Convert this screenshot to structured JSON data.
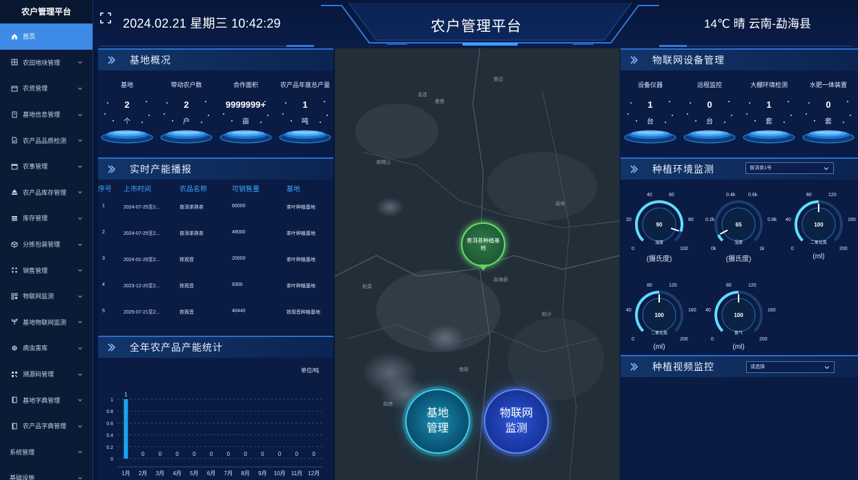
{
  "sidebar": {
    "brand": "农户管理平台",
    "items": [
      {
        "label": "首页",
        "icon": "home-icon",
        "active": true
      },
      {
        "label": "农田地块管理",
        "icon": "grid-icon"
      },
      {
        "label": "农资管理",
        "icon": "box-icon"
      },
      {
        "label": "基地信息管理",
        "icon": "document-icon"
      },
      {
        "label": "农产品品质检测",
        "icon": "file-check-icon"
      },
      {
        "label": "农事管理",
        "icon": "calendar-icon"
      },
      {
        "label": "农产品库存管理",
        "icon": "eject-icon"
      },
      {
        "label": "库存管理",
        "icon": "stack-icon"
      },
      {
        "label": "分拣包装管理",
        "icon": "package-icon"
      },
      {
        "label": "销售管理",
        "icon": "apps-icon"
      },
      {
        "label": "物联网监测",
        "icon": "device-grid-icon"
      },
      {
        "label": "基地物联网监测",
        "icon": "sprout-icon"
      },
      {
        "label": "病虫害库",
        "icon": "bug-icon"
      },
      {
        "label": "溯源码管理",
        "icon": "qrcode-icon"
      },
      {
        "label": "基地字典管理",
        "icon": "book-icon"
      },
      {
        "label": "农产品字典管理",
        "icon": "book-icon"
      },
      {
        "label": "系统管理",
        "icon": ""
      },
      {
        "label": "基础设施",
        "icon": ""
      }
    ]
  },
  "header": {
    "datetime": "2024.02.21 星期三 10:42:29",
    "title": "农户管理平台",
    "weather": "14℃  晴  云南-勐海县"
  },
  "base_overview": {
    "title": "基地概况",
    "stats": [
      {
        "name": "基地",
        "value": "2",
        "unit": "个"
      },
      {
        "name": "带动农户数",
        "value": "2",
        "unit": "户"
      },
      {
        "name": "合作面积",
        "value": "9999999+",
        "unit": "亩"
      },
      {
        "name": "农产品年度总产量",
        "value": "1",
        "unit": "吨"
      }
    ]
  },
  "realtime": {
    "title": "实时产能播报",
    "headers": [
      "序号",
      "上市时间",
      "农品名称",
      "可销售量",
      "基地"
    ],
    "rows": [
      [
        "1",
        "2024-07-25至2...",
        "普洱茶熟茶",
        "60000",
        "茶叶种植基地"
      ],
      [
        "2",
        "2024-07-25至2...",
        "普洱茶熟茶",
        "49000",
        "茶叶种植基地"
      ],
      [
        "3",
        "2024-01-29至2...",
        "铁观音",
        "20000",
        "茶叶种植基地"
      ],
      [
        "4",
        "2023-12-20至2...",
        "铁观音",
        "9300",
        "茶叶种植基地"
      ],
      [
        "5",
        "2025-07-21至2...",
        "铁观音",
        "40440",
        "铁观音种植基地"
      ]
    ]
  },
  "annual": {
    "title": "全年农产品产能统计",
    "unit": "单位/吨"
  },
  "chart_data": {
    "type": "bar",
    "categories": [
      "1月",
      "2月",
      "3月",
      "4月",
      "5月",
      "6月",
      "7月",
      "8月",
      "9月",
      "10月",
      "11月",
      "12月"
    ],
    "values": [
      1,
      0,
      0,
      0,
      0,
      0,
      0,
      0,
      0,
      0,
      0,
      0
    ],
    "ylim": [
      0,
      1
    ],
    "yticks": [
      "0",
      "0.2",
      "0.4",
      "0.6",
      "0.8",
      "1"
    ],
    "ylabel": "单位/吨",
    "grid": true
  },
  "map": {
    "marker_label": "普洱茶种植基地",
    "btn_base": "基地\n管理",
    "btn_iot": "物联网\n监测",
    "labels": [
      "孟连",
      "曼景",
      "勐海县",
      "南糯山",
      "勐宋",
      "帕真",
      "帕沙",
      "南板",
      "勐遮",
      "景迈"
    ]
  },
  "iot": {
    "title": "物联网设备管理",
    "stats": [
      {
        "name": "设备仪器",
        "value": "1",
        "unit": "台"
      },
      {
        "name": "远程监控",
        "value": "0",
        "unit": "台"
      },
      {
        "name": "大棚环境检测",
        "value": "1",
        "unit": "套"
      },
      {
        "name": "水肥一体装置",
        "value": "0",
        "unit": "套"
      }
    ]
  },
  "env": {
    "title": "种植环境监测",
    "select": "普洱茶1号",
    "gauges": [
      {
        "value": "90",
        "name": "温度",
        "unit": "(摄氏度)",
        "ticks": [
          "0",
          "20",
          "40",
          "60",
          "80",
          "100"
        ],
        "fraction": 0.9
      },
      {
        "value": "65",
        "name": "湿度",
        "unit": "(摄氏度)",
        "ticks": [
          "0k",
          "0.2k",
          "0.4k",
          "0.6k",
          "0.8k",
          "1k"
        ],
        "fraction": 0.065
      },
      {
        "value": "100",
        "name": "二氧化氮",
        "unit": "(ml)",
        "ticks": [
          "0",
          "40",
          "80",
          "120",
          "160",
          "200"
        ],
        "fraction": 0.5
      },
      {
        "value": "100",
        "name": "二氧化氮",
        "unit": "(ml)",
        "ticks": [
          "0",
          "40",
          "80",
          "120",
          "160",
          "200"
        ],
        "fraction": 0.5
      },
      {
        "value": "100",
        "name": "氨气",
        "unit": "(ml)",
        "ticks": [
          "0",
          "40",
          "80",
          "120",
          "160",
          "200"
        ],
        "fraction": 0.5
      }
    ]
  },
  "video": {
    "title": "种植视频监控",
    "select": "请选择"
  },
  "colors": {
    "accent": "#3d8be6",
    "panel": "#0a1b44",
    "header_text": "#3fa5ff",
    "bar": "#1aa4ef"
  }
}
